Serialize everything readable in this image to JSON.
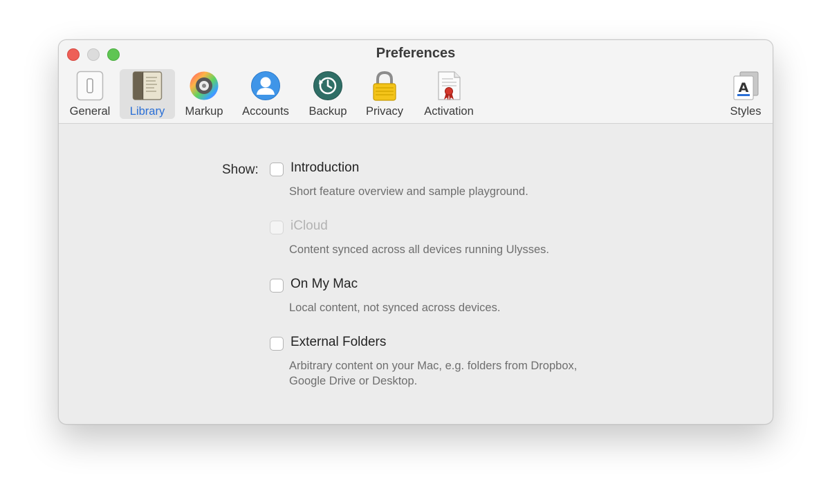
{
  "window": {
    "title": "Preferences"
  },
  "toolbar": {
    "items": [
      {
        "label": "General",
        "icon": "switch-icon"
      },
      {
        "label": "Library",
        "icon": "library-book-icon",
        "selected": true
      },
      {
        "label": "Markup",
        "icon": "color-wheel-icon"
      },
      {
        "label": "Accounts",
        "icon": "person-icon"
      },
      {
        "label": "Backup",
        "icon": "time-machine-icon"
      },
      {
        "label": "Privacy",
        "icon": "padlock-icon"
      },
      {
        "label": "Activation",
        "icon": "certificate-icon"
      },
      {
        "label": "Styles",
        "icon": "font-styles-icon"
      }
    ],
    "selected_color": "#2a6fd6"
  },
  "library": {
    "show_label": "Show:",
    "options": [
      {
        "label": "Introduction",
        "description": "Short feature overview and sample playground.",
        "checked": false,
        "enabled": true
      },
      {
        "label": "iCloud",
        "description": "Content synced across all devices running Ulysses.",
        "checked": false,
        "enabled": false
      },
      {
        "label": "On My Mac",
        "description": "Local content, not synced across devices.",
        "checked": false,
        "enabled": true
      },
      {
        "label": "External Folders",
        "description": "Arbitrary content on your Mac, e.g. folders from Dropbox, Google Drive or Desktop.",
        "checked": false,
        "enabled": true
      }
    ]
  }
}
